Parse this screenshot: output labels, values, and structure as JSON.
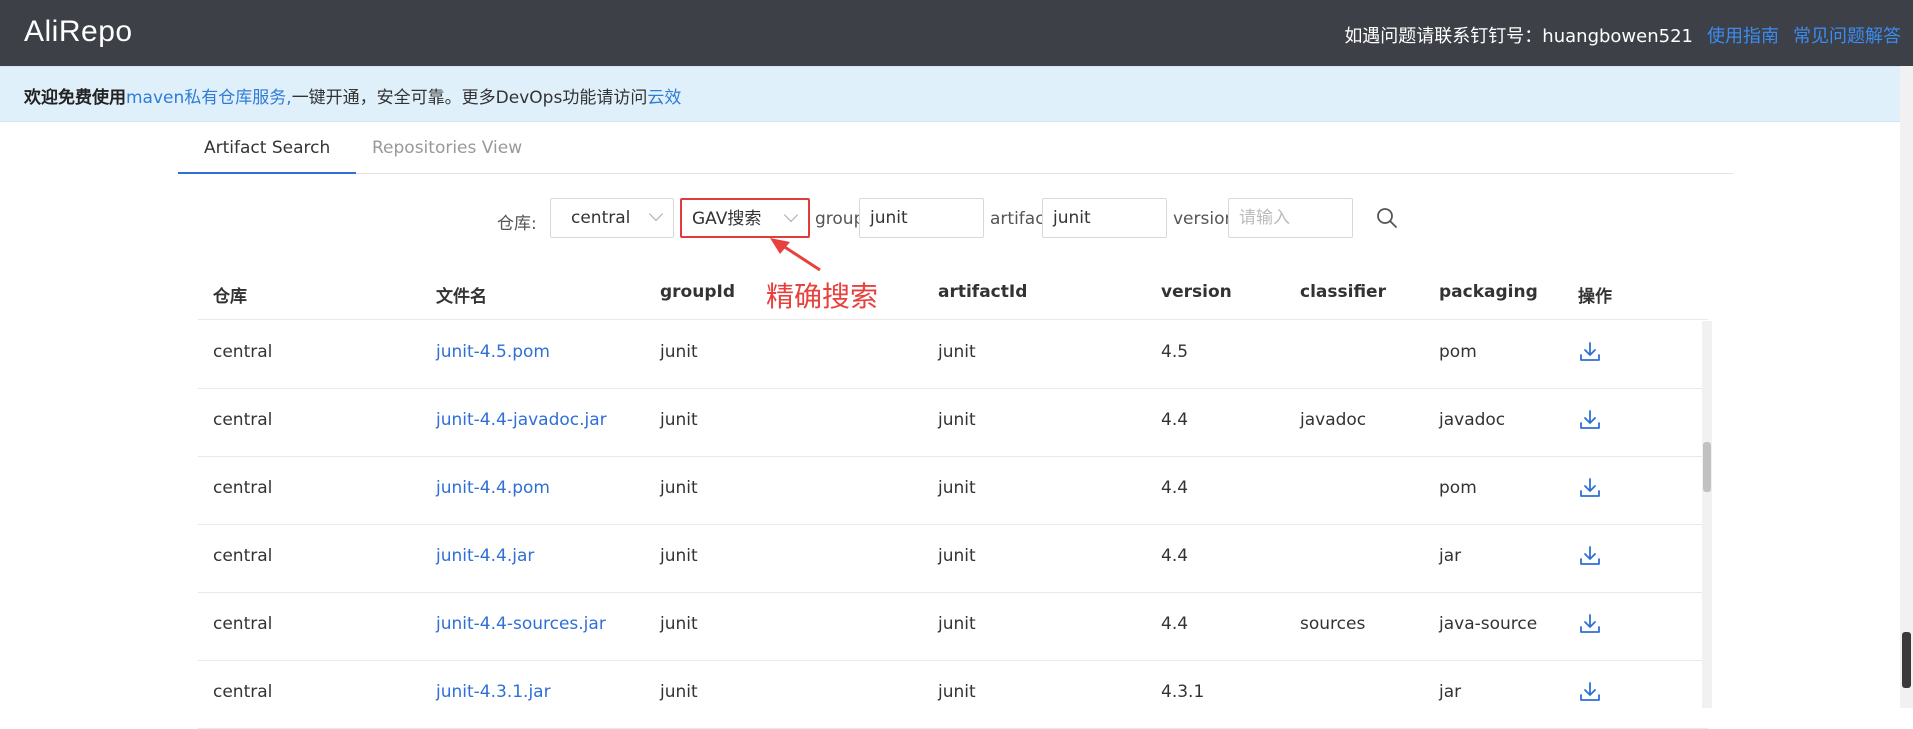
{
  "header": {
    "logo": "AliRepo",
    "contact": "如遇问题请联系钉钉号：huangbowen521",
    "guide_link": "使用指南",
    "faq_link": "常见问题解答"
  },
  "notice": {
    "bold": "欢迎免费使用",
    "link1": "maven私有仓库服务,",
    "mid": "一键开通，安全可靠。更多DevOps功能请访问",
    "link2": "云效"
  },
  "tabs": [
    {
      "label": "Artifact Search",
      "active": true
    },
    {
      "label": "Repositories View",
      "active": false
    }
  ],
  "search": {
    "repo_label": "仓库:",
    "repo_value": "central",
    "mode_value": "GAV搜索",
    "group_label": "group",
    "group_value": "junit",
    "artifact_label": "artifact",
    "artifact_value": "junit",
    "version_label": "version",
    "version_placeholder": "请输入"
  },
  "annotation": {
    "text": "精确搜索",
    "color": "#e8413d"
  },
  "table": {
    "columns": [
      "仓库",
      "文件名",
      "groupId",
      "artifactId",
      "version",
      "classifier",
      "packaging",
      "操作"
    ],
    "rows": [
      {
        "repo": "central",
        "file": "junit-4.5.pom",
        "group": "junit",
        "artifact": "junit",
        "version": "4.5",
        "classifier": "",
        "packaging": "pom"
      },
      {
        "repo": "central",
        "file": "junit-4.4-javadoc.jar",
        "group": "junit",
        "artifact": "junit",
        "version": "4.4",
        "classifier": "javadoc",
        "packaging": "javadoc"
      },
      {
        "repo": "central",
        "file": "junit-4.4.pom",
        "group": "junit",
        "artifact": "junit",
        "version": "4.4",
        "classifier": "",
        "packaging": "pom"
      },
      {
        "repo": "central",
        "file": "junit-4.4.jar",
        "group": "junit",
        "artifact": "junit",
        "version": "4.4",
        "classifier": "",
        "packaging": "jar"
      },
      {
        "repo": "central",
        "file": "junit-4.4-sources.jar",
        "group": "junit",
        "artifact": "junit",
        "version": "4.4",
        "classifier": "sources",
        "packaging": "java-source"
      },
      {
        "repo": "central",
        "file": "junit-4.3.1.jar",
        "group": "junit",
        "artifact": "junit",
        "version": "4.3.1",
        "classifier": "",
        "packaging": "jar"
      }
    ]
  },
  "icons": {
    "download": "download-icon",
    "search": "search-icon"
  },
  "colors": {
    "topbar": "#3d4046",
    "link": "#2f6fd6",
    "highlight": "#e03c3c"
  }
}
